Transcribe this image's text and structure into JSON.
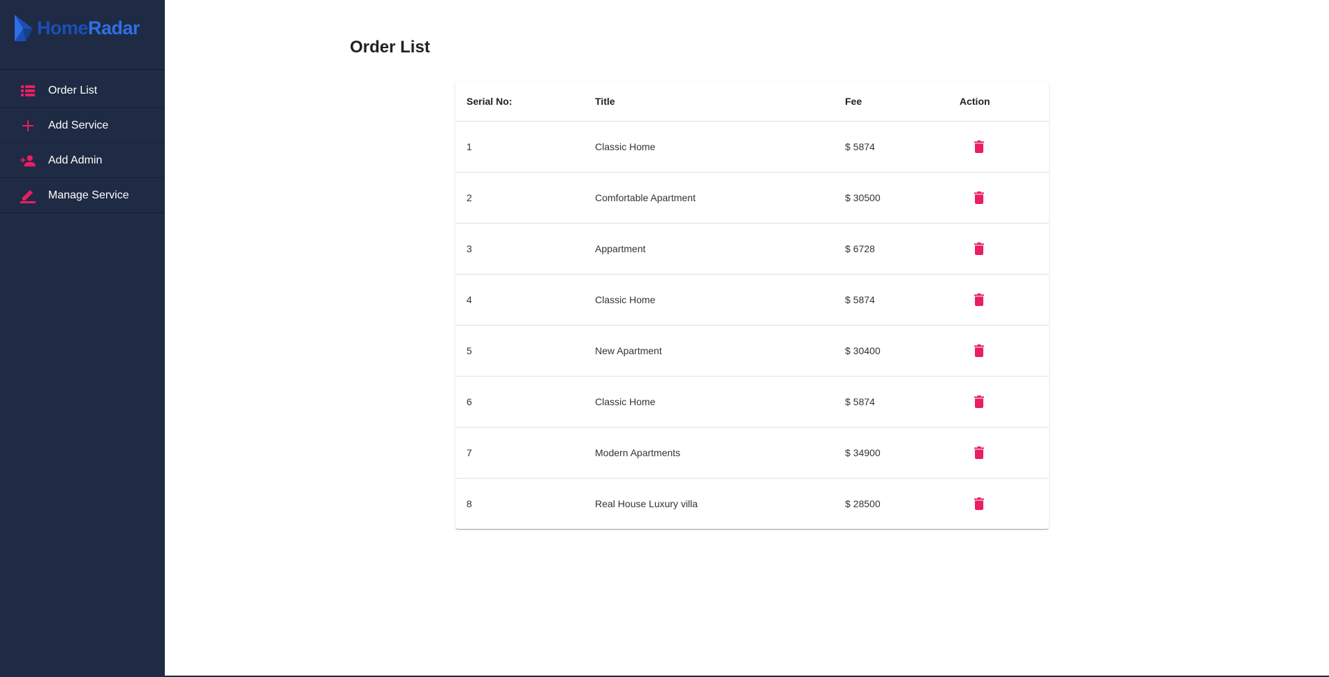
{
  "brand": {
    "name_part1": "Home",
    "name_part2": "Radar"
  },
  "colors": {
    "sidebar_bg": "#1f2a44",
    "accent": "#e91e63",
    "brand_blue": "#2f6fe6"
  },
  "sidebar": {
    "items": [
      {
        "label": "Order List",
        "icon": "list-icon"
      },
      {
        "label": "Add Service",
        "icon": "plus-icon"
      },
      {
        "label": "Add Admin",
        "icon": "person-add-icon"
      },
      {
        "label": "Manage Service",
        "icon": "edit-icon"
      }
    ]
  },
  "main": {
    "title": "Order List",
    "table": {
      "columns": [
        "Serial No:",
        "Title",
        "Fee",
        "Action"
      ],
      "rows": [
        {
          "serial": "1",
          "title": "Classic Home",
          "fee": "$ 5874"
        },
        {
          "serial": "2",
          "title": "Comfortable Apartment",
          "fee": "$ 30500"
        },
        {
          "serial": "3",
          "title": "Appartment",
          "fee": "$ 6728"
        },
        {
          "serial": "4",
          "title": "Classic Home",
          "fee": "$ 5874"
        },
        {
          "serial": "5",
          "title": "New Apartment",
          "fee": "$ 30400"
        },
        {
          "serial": "6",
          "title": "Classic Home",
          "fee": "$ 5874"
        },
        {
          "serial": "7",
          "title": "Modern Apartments",
          "fee": "$ 34900"
        },
        {
          "serial": "8",
          "title": "Real House Luxury villa",
          "fee": "$ 28500"
        }
      ]
    }
  }
}
